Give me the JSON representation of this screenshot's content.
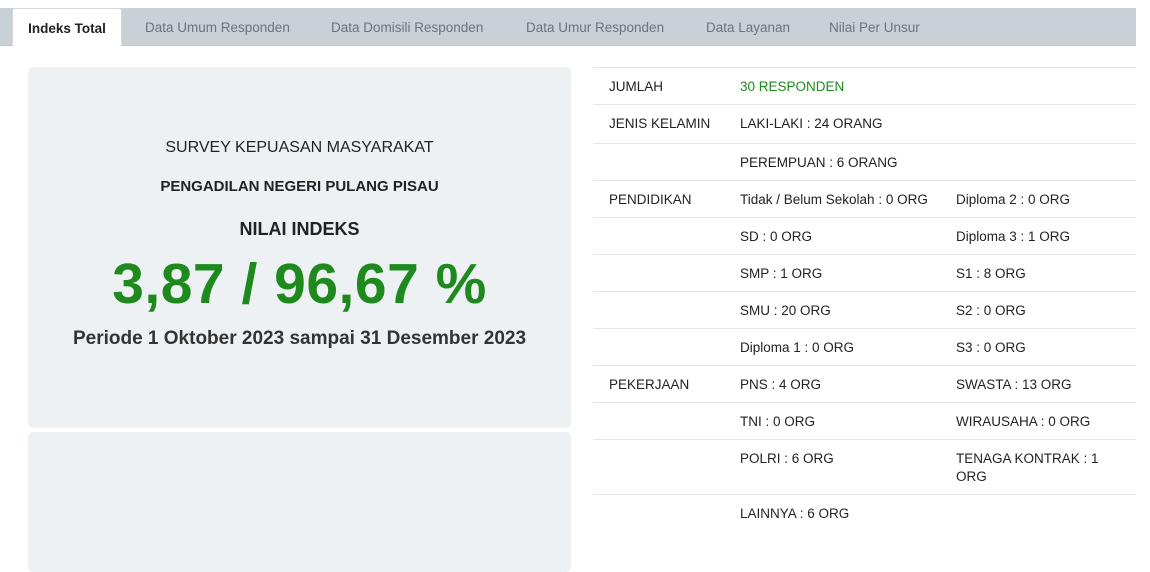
{
  "tabs": [
    {
      "label": "Indeks Total",
      "active": true
    },
    {
      "label": "Data Umum Responden"
    },
    {
      "label": "Data Domisili Responden"
    },
    {
      "label": "Data Umur Responden"
    },
    {
      "label": "Data Layanan"
    },
    {
      "label": "Nilai Per Unsur"
    }
  ],
  "summary": {
    "survey_title": "SURVEY KEPUASAN MASYARAKAT",
    "institution": "PENGADILAN NEGERI PULANG PISAU",
    "index_label": "NILAI INDEKS",
    "index_value": "3,87 / 96,67 %",
    "period": "Periode 1 Oktober 2023 sampai 31 Desember 2023"
  },
  "stats": {
    "jumlah_label": "JUMLAH",
    "jumlah_value": "30 RESPONDEN",
    "gender_label": "JENIS KELAMIN",
    "male": "LAKI-LAKI : 24 ORANG",
    "female": "PEREMPUAN : 6 ORANG",
    "education_label": "PENDIDIKAN",
    "education": [
      [
        "Tidak / Belum Sekolah : 0 ORG",
        "Diploma 2 : 0 ORG"
      ],
      [
        "SD : 0 ORG",
        "Diploma 3 : 1 ORG"
      ],
      [
        "SMP : 1 ORG",
        "S1 : 8 ORG"
      ],
      [
        "SMU : 20 ORG",
        "S2 : 0 ORG"
      ],
      [
        "Diploma 1 : 0 ORG",
        "S3 : 0 ORG"
      ]
    ],
    "job_label": "PEKERJAAN",
    "jobs": [
      [
        "PNS : 4 ORG",
        "SWASTA : 13 ORG"
      ],
      [
        "TNI : 0 ORG",
        "WIRAUSAHA : 0 ORG"
      ],
      [
        "POLRI : 6 ORG",
        "TENAGA KONTRAK : 1 ORG"
      ],
      [
        "LAINNYA : 6 ORG",
        ""
      ]
    ]
  },
  "colors": {
    "accent_green": "#1e8a1e",
    "tabbar": "#c9d0d6",
    "panel": "#eef1f3"
  }
}
